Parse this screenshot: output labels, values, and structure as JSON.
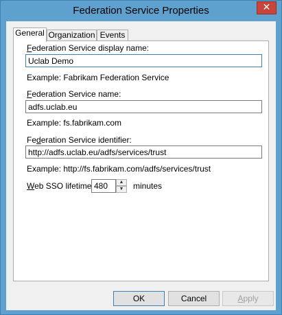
{
  "window": {
    "title": "Federation Service Properties",
    "close_glyph": "✕"
  },
  "tabs": [
    {
      "label": "General",
      "active": true
    },
    {
      "label": "Organization",
      "active": false
    },
    {
      "label": "Events",
      "active": false
    }
  ],
  "general": {
    "display_name": {
      "label_access": "F",
      "label_rest": "ederation Service display name:",
      "value": "Uclab Demo",
      "example": "Example: Fabrikam Federation Service"
    },
    "service_name": {
      "label_access": "F",
      "label_rest": "ederation Service name:",
      "value": "adfs.uclab.eu",
      "example": "Example: fs.fabrikam.com"
    },
    "identifier": {
      "label_pre": "Fe",
      "label_access": "d",
      "label_rest": "eration Service identifier:",
      "value": "http://adfs.uclab.eu/adfs/services/trust",
      "example": "Example: http://fs.fabrikam.com/adfs/services/trust"
    },
    "sso": {
      "label_access": "W",
      "label_rest": "eb SSO lifetime:",
      "value": "480",
      "unit": "minutes",
      "up_glyph": "▲",
      "down_glyph": "▼"
    }
  },
  "buttons": {
    "ok": "OK",
    "cancel": "Cancel",
    "apply_access": "A",
    "apply_rest": "pply"
  }
}
